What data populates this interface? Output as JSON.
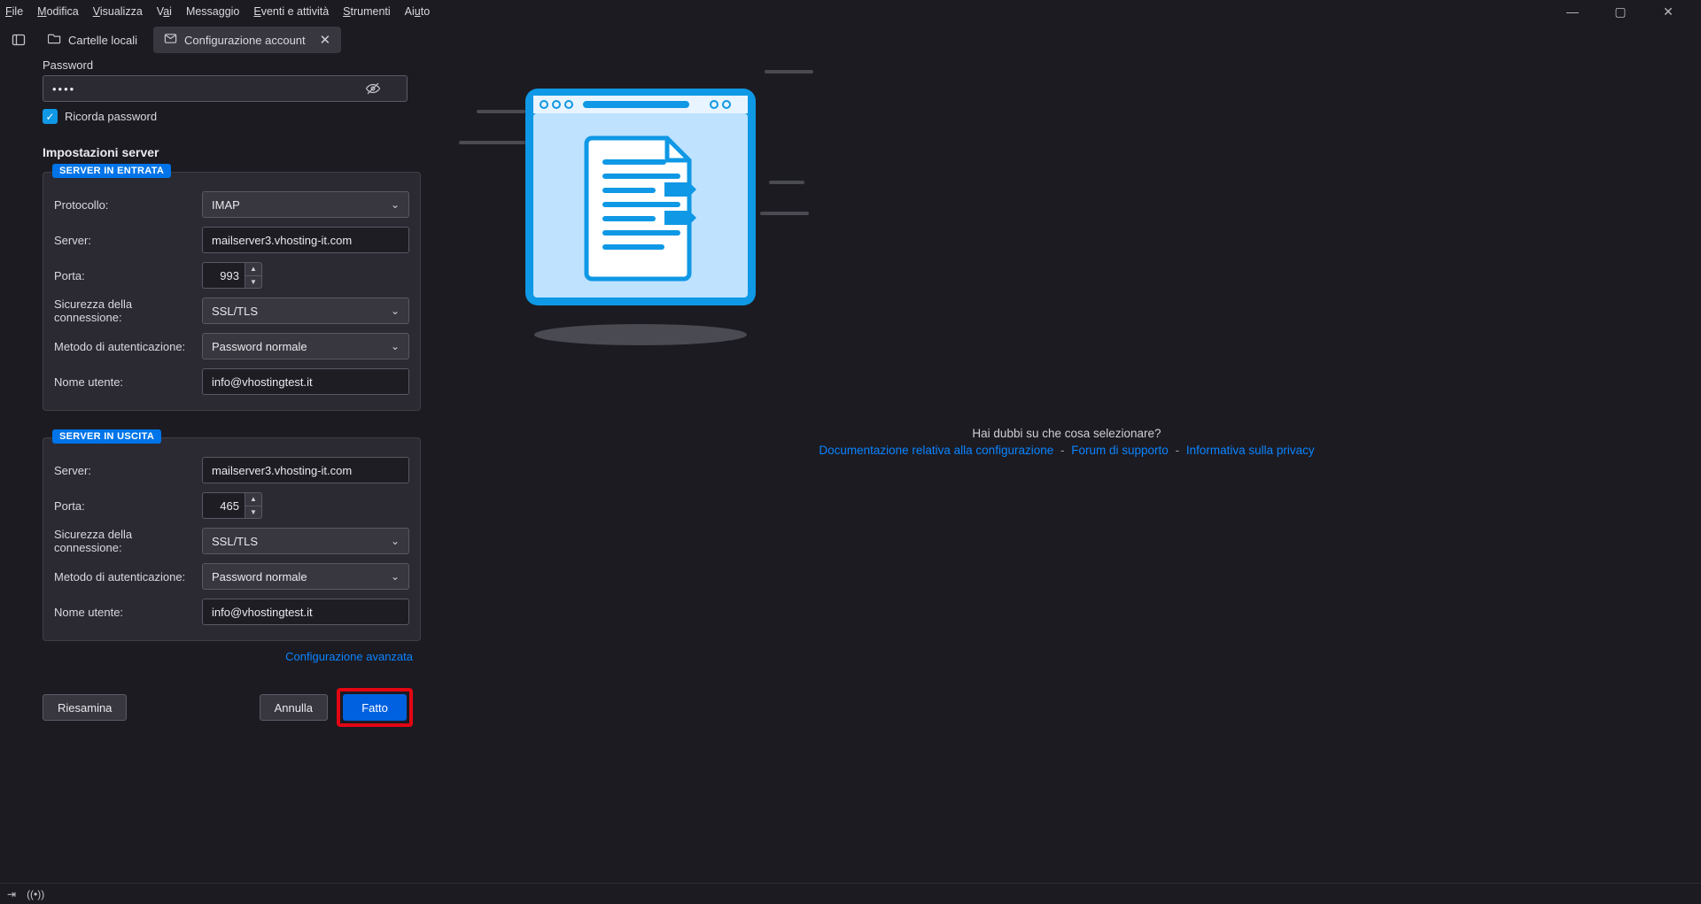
{
  "menu": {
    "file": "File",
    "edit": "Modifica",
    "view": "Visualizza",
    "go": "Vai",
    "message": "Messaggio",
    "events": "Eventi e attività",
    "tools": "Strumenti",
    "help": "Aiuto"
  },
  "tabs": {
    "local": "Cartelle locali",
    "config": "Configurazione account"
  },
  "form": {
    "password_label": "Password",
    "password_value": "••••",
    "remember_label": "Ricorda password",
    "server_settings_title": "Impostazioni server",
    "incoming_legend": "SERVER IN ENTRATA",
    "outgoing_legend": "SERVER IN USCITA",
    "labels": {
      "protocol": "Protocollo:",
      "server": "Server:",
      "port": "Porta:",
      "security": "Sicurezza della connessione:",
      "auth": "Metodo di autenticazione:",
      "username": "Nome utente:"
    },
    "incoming": {
      "protocol": "IMAP",
      "server": "mailserver3.vhosting-it.com",
      "port": "993",
      "security": "SSL/TLS",
      "auth": "Password normale",
      "username": "info@vhostingtest.it"
    },
    "outgoing": {
      "server": "mailserver3.vhosting-it.com",
      "port": "465",
      "security": "SSL/TLS",
      "auth": "Password normale",
      "username": "info@vhostingtest.it"
    },
    "advanced_link": "Configurazione avanzata",
    "buttons": {
      "retest": "Riesamina",
      "cancel": "Annulla",
      "done": "Fatto"
    }
  },
  "help": {
    "question": "Hai dubbi su che cosa selezionare?",
    "doc": "Documentazione relativa alla configurazione",
    "forum": "Forum di supporto",
    "privacy": "Informativa sulla privacy"
  }
}
